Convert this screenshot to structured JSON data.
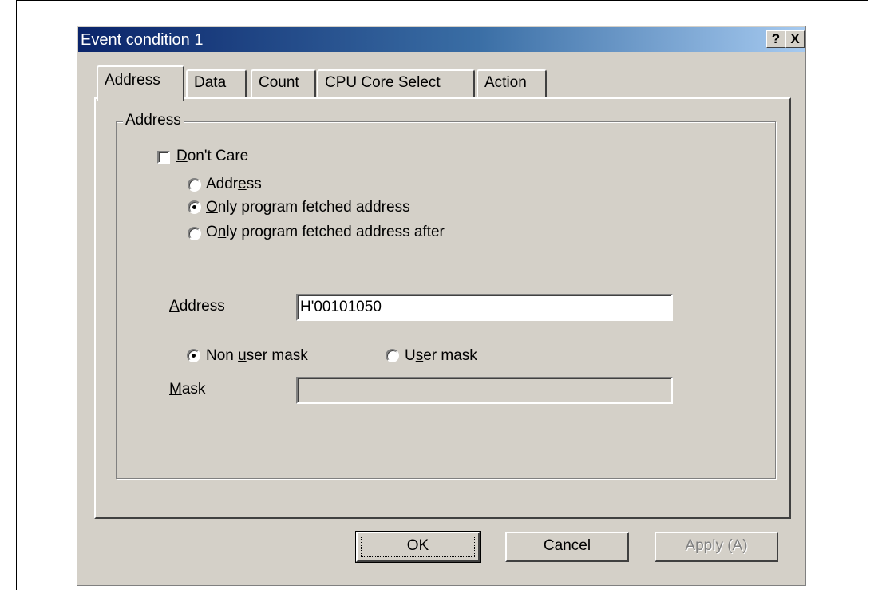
{
  "window": {
    "title": "Event condition 1",
    "help_label": "?",
    "close_label": "X"
  },
  "tabs": [
    {
      "label": "Address",
      "active": true
    },
    {
      "label": "Data",
      "active": false
    },
    {
      "label": "Count",
      "active": false
    },
    {
      "label": "CPU Core Select",
      "active": false
    },
    {
      "label": "Action",
      "active": false
    }
  ],
  "group": {
    "legend": "Address",
    "dont_care": {
      "label": "Don't Care",
      "checked": false
    },
    "radios": [
      {
        "label": "Address",
        "selected": false
      },
      {
        "label": "Only program fetched address",
        "selected": true
      },
      {
        "label": "Only program fetched address after",
        "selected": false
      }
    ],
    "address": {
      "label": "Address",
      "value": "H'00101050"
    },
    "mask_radios": [
      {
        "label": "Non user mask",
        "selected": true
      },
      {
        "label": "User mask",
        "selected": false
      }
    ],
    "mask": {
      "label": "Mask",
      "value": ""
    }
  },
  "buttons": {
    "ok": "OK",
    "cancel": "Cancel",
    "apply": "Apply (A)"
  }
}
